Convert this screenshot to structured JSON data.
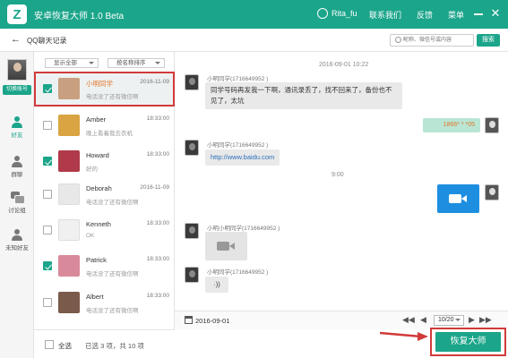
{
  "app": {
    "title": "安卓恢复大师 1.0 Beta",
    "logo_letter": "Z",
    "accent": "#1ba58a",
    "highlight": "#d23a3a"
  },
  "titlebar": {
    "user": "Rita_fu",
    "contact_us": "联系我们",
    "feedback": "反馈",
    "menu": "菜单"
  },
  "subbar": {
    "title": "QQ聊天记录",
    "search_placeholder": "昵称、微信号或内容",
    "search_button": "搜索"
  },
  "leftnav": {
    "switch_account": "切换账号",
    "items": [
      {
        "label": "好友",
        "icon": "person-icon",
        "active": true
      },
      {
        "label": "群聊",
        "icon": "group-icon",
        "active": false
      },
      {
        "label": "讨论组",
        "icon": "discussion-icon",
        "active": false
      },
      {
        "label": "未知好友",
        "icon": "unknown-friend-icon",
        "active": false
      }
    ]
  },
  "contacts": {
    "filter_show": "显示全部",
    "filter_sort": "按名称排序",
    "items": [
      {
        "name": "小明同学",
        "date": "2016-11-09",
        "preview": "电话没了还有微信啊",
        "checked": true,
        "selected": true,
        "avatar": "#c8a080"
      },
      {
        "name": "Amber",
        "date": "18:33:00",
        "preview": "晚上看着我去衣机",
        "checked": false,
        "selected": false,
        "avatar": "#d9a441"
      },
      {
        "name": "Howard",
        "date": "18:33:00",
        "preview": "好的",
        "checked": true,
        "selected": false,
        "avatar": "#b03a4a"
      },
      {
        "name": "Deborah",
        "date": "2016-11-09",
        "preview": "电话没了还有微信啊",
        "checked": false,
        "selected": false,
        "avatar": "#e8e8e8"
      },
      {
        "name": "Kenneth",
        "date": "18:33:00",
        "preview": "OK",
        "checked": false,
        "selected": false,
        "avatar": "#f0f0f0"
      },
      {
        "name": "Patrick",
        "date": "18:33:00",
        "preview": "电话没了还有微信啊",
        "checked": true,
        "selected": false,
        "avatar": "#d98a9a"
      },
      {
        "name": "Albert",
        "date": "18:33:00",
        "preview": "电话没了还有微信啊",
        "checked": false,
        "selected": false,
        "avatar": "#7a5a4a"
      }
    ]
  },
  "bottom": {
    "select_all": "全选",
    "selected_count": "已选 3 项，共 10 项"
  },
  "chat": {
    "time1": "2016-09-01 10:22",
    "msg1_sender": "小明同学(1716649952 )",
    "msg1_line1": "同学号码再发我一下啊，通讯录丢了，找不回来了，备份也不",
    "msg1_line2": "见了，太坑",
    "msg2_right": "1866*   *  *05",
    "msg3_sender": "小明同学(1716649952 )",
    "msg3_link": "http://www.baidu.com",
    "time2": "9:00",
    "msg5_sender": "小明小明同学(1716649952 )",
    "msg6_sender": "小明同学(1716649952 )",
    "msg6_voice": "·))"
  },
  "footer": {
    "date": "2016-09-01",
    "page": "10/20"
  },
  "restore_button": "恢复大师"
}
